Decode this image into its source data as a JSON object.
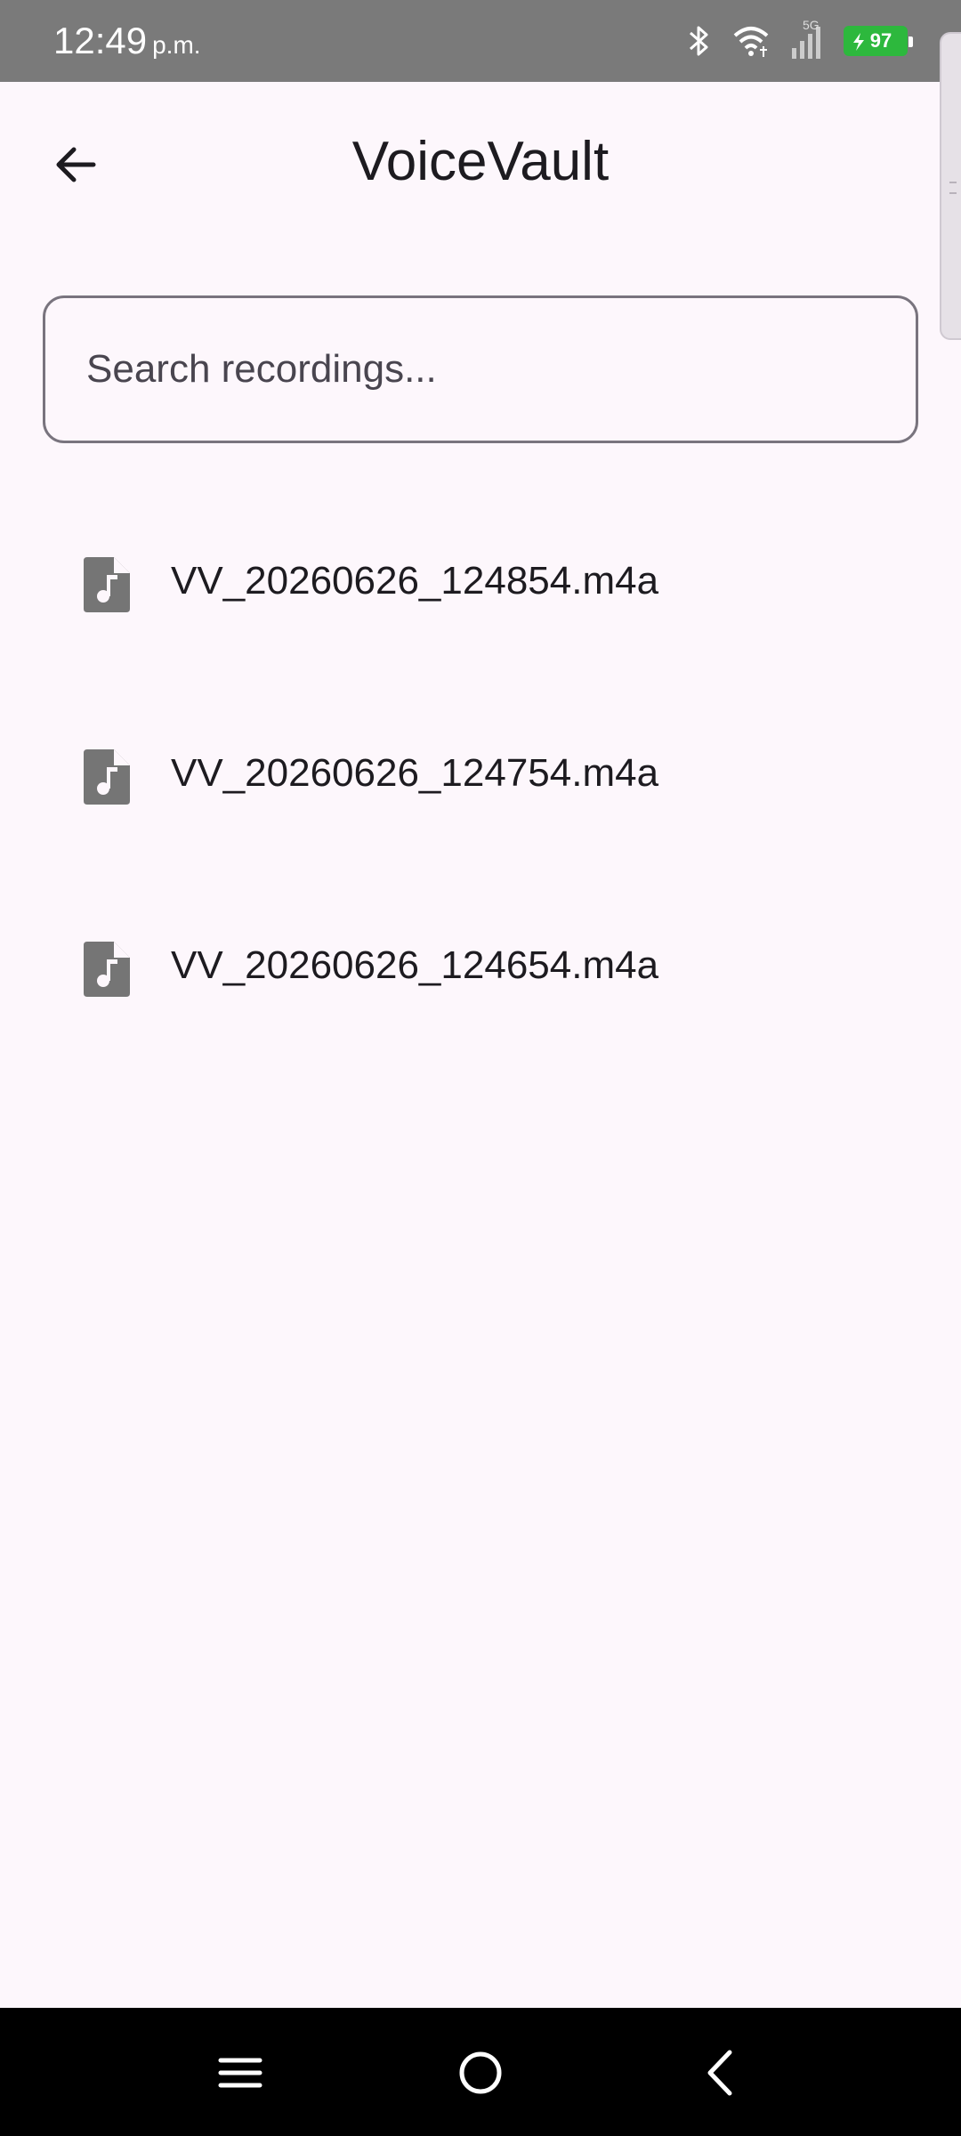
{
  "status_bar": {
    "time": "12:49",
    "ampm": "p.m.",
    "network_label": "5G",
    "battery_level": "97",
    "icons": [
      "bluetooth-icon",
      "wifi-icon",
      "cellular-signal-icon",
      "battery-charging-icon"
    ],
    "battery_color": "#2db83d"
  },
  "app_bar": {
    "title": "VoiceVault",
    "back_icon": "arrow-back-icon"
  },
  "search": {
    "placeholder": "Search recordings...",
    "value": ""
  },
  "recordings": [
    {
      "name": "VV_20260626_124854.m4a",
      "icon": "audio-file-icon"
    },
    {
      "name": "VV_20260626_124754.m4a",
      "icon": "audio-file-icon"
    },
    {
      "name": "VV_20260626_124654.m4a",
      "icon": "audio-file-icon"
    }
  ],
  "nav_bar": {
    "icons": [
      "menu-icon",
      "home-icon",
      "back-icon"
    ]
  },
  "colors": {
    "background": "#fdf7fc",
    "text": "#1d1b20",
    "outline": "#79747e",
    "icon_gray": "#757575"
  }
}
